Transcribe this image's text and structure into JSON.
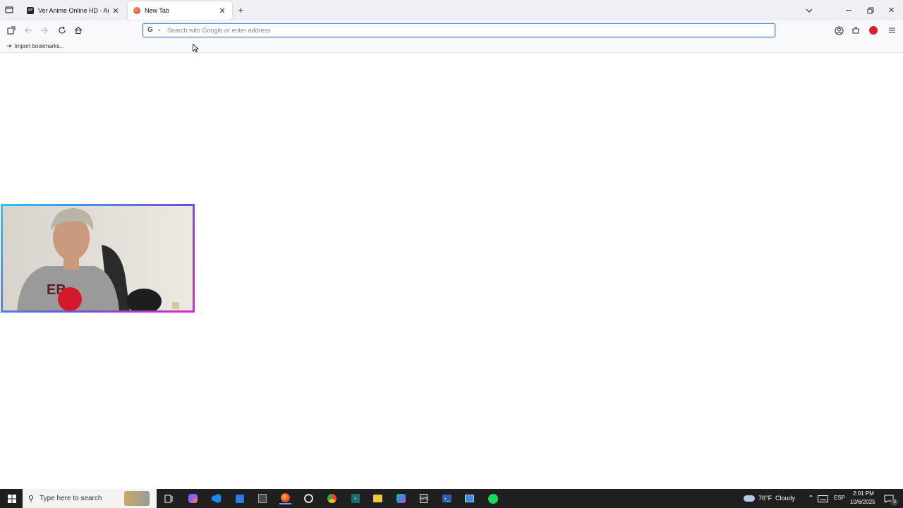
{
  "browser": {
    "tabs": [
      {
        "label": "Ver Anime Online HD - AnimeFLV",
        "active": false,
        "favicon_color": "#222222"
      },
      {
        "label": "New Tab",
        "active": true,
        "favicon_color": "#e8632a"
      }
    ],
    "new_tab_icon": "plus-icon",
    "window_controls": {
      "list_all_tabs": "chevron-down-icon",
      "minimize": "minimize-icon",
      "restore": "restore-icon",
      "close": "close-icon"
    },
    "urlbar": {
      "engine_icon": "google-icon",
      "placeholder": "Search with Google or enter address",
      "value": ""
    },
    "bookmarks": {
      "import_label": "Import bookmarks..."
    }
  },
  "taskbar": {
    "search_placeholder": "Type here to search",
    "weather": {
      "temp": "76°F",
      "condition": "Cloudy"
    },
    "language": "ESP",
    "time": "2:01 PM",
    "date": "10/6/2025",
    "notification_count": "3",
    "accent": "#1f1f1f"
  }
}
